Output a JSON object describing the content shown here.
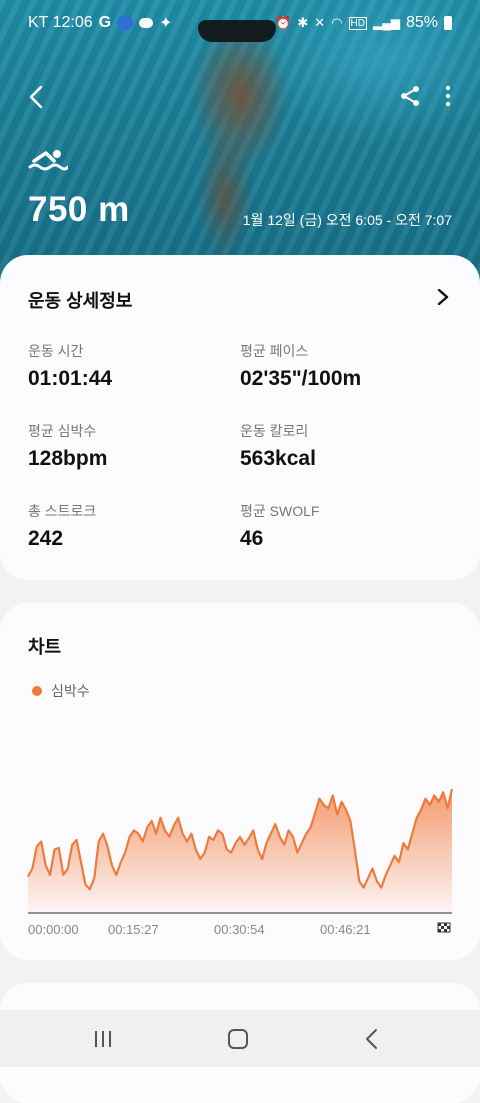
{
  "status_bar": {
    "carrier_time": "KT 12:06",
    "battery": "85%",
    "left_icons": [
      "G",
      "sol",
      "cloud",
      "leaf"
    ],
    "right_icons": [
      "alarm",
      "bluetooth",
      "mute",
      "wifi",
      "hd",
      "signal",
      "battery"
    ]
  },
  "header": {
    "distance": "750 m",
    "date_range": "1월 12일 (금) 오전 6:05 - 오전 7:07",
    "icons": [
      "back-icon",
      "share-icon",
      "more-icon",
      "swimming-icon"
    ]
  },
  "details": {
    "title": "운동 상세정보",
    "stats": [
      {
        "label": "운동 시간",
        "value": "01:01:44",
        "unit": ""
      },
      {
        "label": "평균 페이스",
        "value": "02'35\"/100m",
        "unit": ""
      },
      {
        "label": "평균 심박수",
        "value": "128",
        "unit": "bpm"
      },
      {
        "label": "운동 칼로리",
        "value": "563",
        "unit": "kcal"
      },
      {
        "label": "총 스트로크",
        "value": "242",
        "unit": ""
      },
      {
        "label": "평균 SWOLF",
        "value": "46",
        "unit": ""
      }
    ]
  },
  "chart_section": {
    "title": "차트",
    "legend": "심박수",
    "color": "#f07a3e"
  },
  "chart_data": {
    "type": "area",
    "title": "",
    "xlabel": "",
    "ylabel": "",
    "x_ticks": [
      "00:00:00",
      "00:15:27",
      "00:30:54",
      "00:46:21"
    ],
    "series": [
      {
        "name": "심박수",
        "values": [
          103,
          108,
          122,
          125,
          110,
          104,
          120,
          121,
          104,
          108,
          123,
          126,
          112,
          98,
          95,
          102,
          125,
          130,
          122,
          110,
          104,
          112,
          118,
          128,
          132,
          130,
          125,
          134,
          138,
          130,
          140,
          132,
          128,
          135,
          140,
          130,
          125,
          130,
          120,
          114,
          118,
          128,
          126,
          132,
          130,
          120,
          118,
          124,
          128,
          123,
          127,
          132,
          120,
          114,
          124,
          130,
          136,
          128,
          123,
          132,
          128,
          118,
          124,
          130,
          134,
          143,
          152,
          148,
          146,
          154,
          142,
          150,
          145,
          138,
          120,
          100,
          96,
          102,
          108,
          100,
          96,
          104,
          110,
          116,
          112,
          124,
          120,
          130,
          140,
          145,
          152,
          148,
          154,
          150,
          156,
          146,
          158
        ]
      }
    ],
    "grid": false
  },
  "navbar": {
    "icons": [
      "recents-icon",
      "home-icon",
      "back-nav-icon"
    ]
  }
}
